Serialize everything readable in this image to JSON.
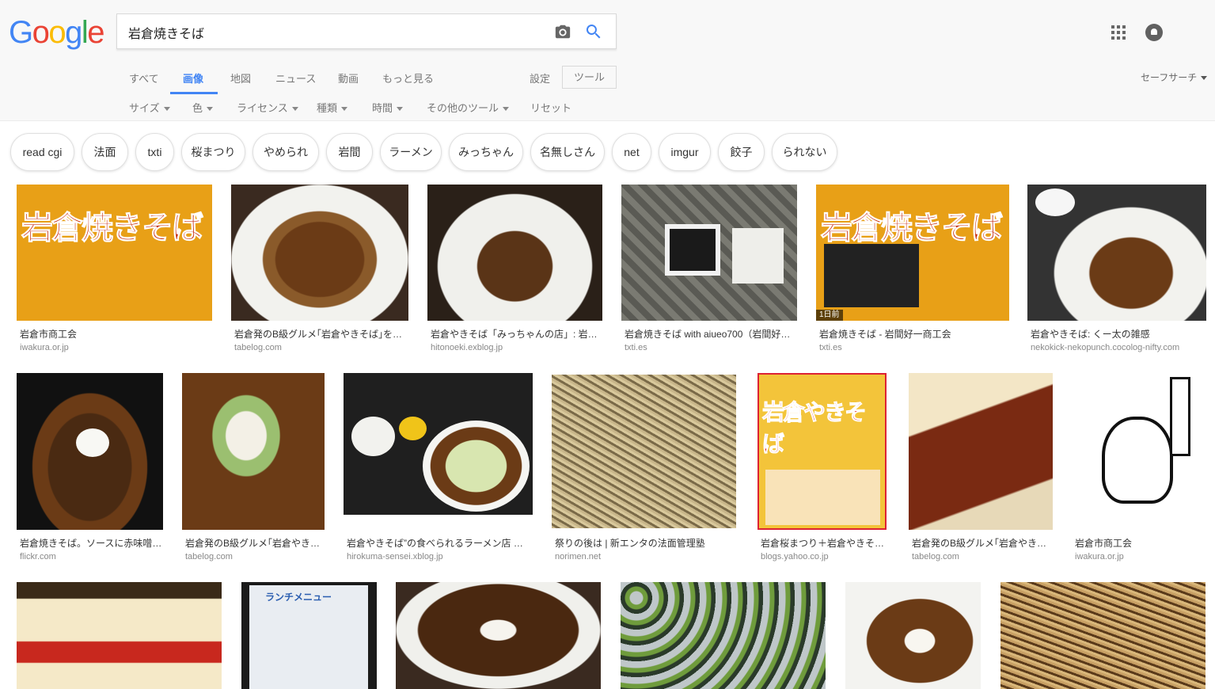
{
  "logo": "Google",
  "search": {
    "query": "岩倉焼きそば"
  },
  "nav": {
    "tabs": [
      "すべて",
      "画像",
      "地図",
      "ニュース",
      "動画",
      "もっと見る"
    ],
    "active": "画像",
    "settings": "設定",
    "tools": "ツール",
    "safesearch": "セーフサーチ"
  },
  "tools_row": [
    "サイズ",
    "色",
    "ライセンス",
    "種類",
    "時間",
    "その他のツール",
    "リセット"
  ],
  "chips": [
    "read cgi",
    "法面",
    "txti",
    "桜まつり",
    "やめられ",
    "岩間",
    "ラーメン",
    "みっちゃん",
    "名無しさん",
    "net",
    "imgur",
    "餃子",
    "られない"
  ],
  "results": [
    {
      "title": "岩倉市商工会",
      "source": "iwakura.or.jp",
      "badge": "",
      "poster_text": "岩倉焼きそば"
    },
    {
      "title": "岩倉発のB級グルメ｢岩倉やきそば｣を…",
      "source": "tabelog.com",
      "badge": "",
      "poster_text": ""
    },
    {
      "title": "岩倉やきそば「みっちゃんの店」: 岩倉…",
      "source": "hitonoeki.exblog.jp",
      "badge": "",
      "poster_text": ""
    },
    {
      "title": "岩倉焼きそば with aiueo700（岩間好…",
      "source": "txti.es",
      "badge": "",
      "poster_text": ""
    },
    {
      "title": "岩倉焼きそば - 岩間好一商工会",
      "source": "txti.es",
      "badge": "1日前",
      "poster_text": "岩倉焼きそば"
    },
    {
      "title": "岩倉やきそば: くー太の雑感",
      "source": "nekokick-nekopunch.cocolog-nifty.com",
      "badge": "",
      "poster_text": ""
    },
    {
      "title": "岩倉焼きそば。ソースに赤味噌…",
      "source": "flickr.com",
      "badge": "",
      "poster_text": ""
    },
    {
      "title": "岩倉発のB級グルメ｢岩倉やき…",
      "source": "tabelog.com",
      "badge": "",
      "poster_text": ""
    },
    {
      "title": "岩倉やきそば”の食べられるラーメン店 み…",
      "source": "hirokuma-sensei.xblog.jp",
      "badge": "",
      "poster_text": ""
    },
    {
      "title": "祭りの後は | 新エンタの法面管理塾",
      "source": "norimen.net",
      "badge": "",
      "poster_text": ""
    },
    {
      "title": "岩倉桜まつり＋岩倉やきそ…",
      "source": "blogs.yahoo.co.jp",
      "badge": "",
      "poster_text": "岩倉やきそば"
    },
    {
      "title": "岩倉発のB級グルメ｢岩倉やき…",
      "source": "tabelog.com",
      "badge": "",
      "poster_text": ""
    },
    {
      "title": "岩倉市商工会",
      "source": "iwakura.or.jp",
      "badge": "",
      "poster_text": ""
    },
    {
      "title": "",
      "source": "",
      "badge": "",
      "poster_text": ""
    },
    {
      "title": "",
      "source": "",
      "badge": "",
      "poster_text": "ランチメニュー"
    },
    {
      "title": "",
      "source": "",
      "badge": "",
      "poster_text": ""
    },
    {
      "title": "",
      "source": "",
      "badge": "",
      "poster_text": ""
    },
    {
      "title": "",
      "source": "",
      "badge": "",
      "poster_text": ""
    },
    {
      "title": "",
      "source": "",
      "badge": "",
      "poster_text": ""
    }
  ]
}
